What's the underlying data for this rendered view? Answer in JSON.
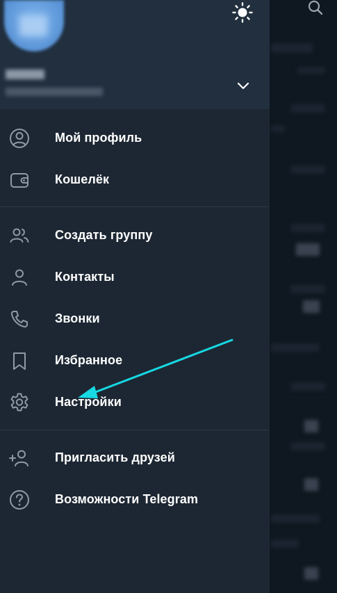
{
  "header": {
    "user_name": "",
    "user_phone": ""
  },
  "menu": {
    "items": [
      {
        "label": "Мой профиль",
        "icon": "profile-icon"
      },
      {
        "label": "Кошелёк",
        "icon": "wallet-icon"
      },
      {
        "label": "Создать группу",
        "icon": "group-icon"
      },
      {
        "label": "Контакты",
        "icon": "contact-icon"
      },
      {
        "label": "Звонки",
        "icon": "phone-icon"
      },
      {
        "label": "Избранное",
        "icon": "bookmark-icon"
      },
      {
        "label": "Настройки",
        "icon": "gear-icon"
      },
      {
        "label": "Пригласить друзей",
        "icon": "add-user-icon"
      },
      {
        "label": "Возможности Telegram",
        "icon": "question-icon"
      }
    ]
  },
  "colors": {
    "drawer_bg": "#1d2733",
    "header_bg": "#212f3e",
    "accent_arrow": "#16d9e3"
  }
}
